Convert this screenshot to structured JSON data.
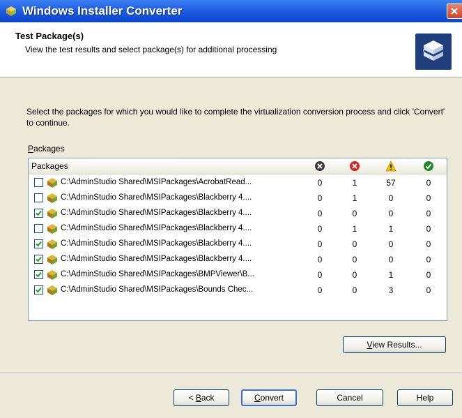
{
  "window": {
    "title": "Windows Installer Converter",
    "close_symbol": "×"
  },
  "header": {
    "title": "Test Package(s)",
    "subtitle": "View the test results and select package(s) for additional processing",
    "icon": "package-box-icon"
  },
  "content": {
    "instruction": "Select the packages for which you would like to complete the virtualization conversion process and click 'Convert' to continue.",
    "packages_label_accel": "P",
    "packages_label_rest": "ackages"
  },
  "list": {
    "column_name": "Packages",
    "column_icons": [
      "blocked-icon",
      "error-icon",
      "warning-icon",
      "success-icon"
    ],
    "rows": [
      {
        "checked": false,
        "path": "C:\\AdminStudio Shared\\MSIPackages\\AcrobatRead...",
        "c1": "0",
        "c2": "1",
        "c3": "57",
        "c4": "0"
      },
      {
        "checked": false,
        "path": "C:\\AdminStudio Shared\\MSIPackages\\Blackberry 4....",
        "c1": "0",
        "c2": "1",
        "c3": "0",
        "c4": "0"
      },
      {
        "checked": true,
        "path": "C:\\AdminStudio Shared\\MSIPackages\\Blackberry 4....",
        "c1": "0",
        "c2": "0",
        "c3": "0",
        "c4": "0"
      },
      {
        "checked": false,
        "path": "C:\\AdminStudio Shared\\MSIPackages\\Blackberry 4....",
        "c1": "0",
        "c2": "1",
        "c3": "1",
        "c4": "0"
      },
      {
        "checked": true,
        "path": "C:\\AdminStudio Shared\\MSIPackages\\Blackberry 4....",
        "c1": "0",
        "c2": "0",
        "c3": "0",
        "c4": "0"
      },
      {
        "checked": true,
        "path": "C:\\AdminStudio Shared\\MSIPackages\\Blackberry 4....",
        "c1": "0",
        "c2": "0",
        "c3": "0",
        "c4": "0"
      },
      {
        "checked": true,
        "path": "C:\\AdminStudio Shared\\MSIPackages\\BMPViewer\\B...",
        "c1": "0",
        "c2": "0",
        "c3": "1",
        "c4": "0"
      },
      {
        "checked": true,
        "path": "C:\\AdminStudio Shared\\MSIPackages\\Bounds Chec...",
        "c1": "0",
        "c2": "0",
        "c3": "3",
        "c4": "0"
      }
    ]
  },
  "buttons": {
    "view_results_accel": "V",
    "view_results_rest": "iew Results...",
    "back_prefix": "< ",
    "back_accel": "B",
    "back_rest": "ack",
    "convert_accel": "C",
    "convert_rest": "onvert",
    "cancel": "Cancel",
    "help": "Help"
  },
  "colors": {
    "titlebar": "#0a46d2",
    "dialog_bg": "#ece9d8",
    "blocked": "#3a3a3a",
    "error": "#d42020",
    "warning": "#f2c400",
    "success": "#1f8a2c"
  }
}
